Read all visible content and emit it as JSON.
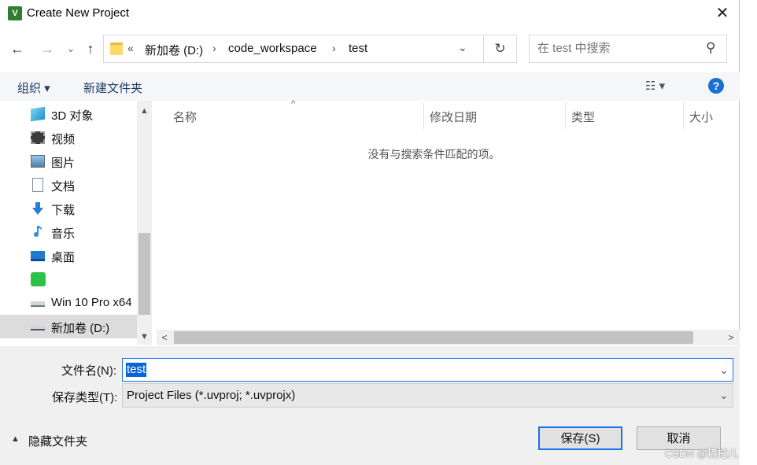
{
  "window": {
    "title": "Create New Project",
    "app_icon_glyph": "V",
    "close_glyph": "✕"
  },
  "nav": {
    "back_glyph": "←",
    "forward_glyph": "→",
    "recent_glyph": "⌄",
    "up_glyph": "↑"
  },
  "address": {
    "overflow": "«",
    "crumbs": [
      "新加卷 (D:)",
      "code_workspace",
      "test"
    ],
    "separator": "›",
    "dropdown_glyph": "⌄",
    "refresh_glyph": "↻"
  },
  "search": {
    "placeholder": "在 test 中搜索",
    "icon_glyph": "⚲"
  },
  "toolbar": {
    "organize": "组织 ▾",
    "new_folder": "新建文件夹",
    "view_glyph": "☷ ▾",
    "help_glyph": "?"
  },
  "sidebar": {
    "items": [
      {
        "label": "3D 对象",
        "icon": "3d-objects-icon"
      },
      {
        "label": "视频",
        "icon": "video-icon"
      },
      {
        "label": "图片",
        "icon": "pictures-icon"
      },
      {
        "label": "文档",
        "icon": "documents-icon"
      },
      {
        "label": "下载",
        "icon": "downloads-icon"
      },
      {
        "label": "音乐",
        "icon": "music-icon"
      },
      {
        "label": "桌面",
        "icon": "desktop-icon"
      },
      {
        "label": "",
        "icon": "iqiyi-icon"
      },
      {
        "label": "Win 10 Pro x64",
        "icon": "drive-icon"
      },
      {
        "label": "新加卷 (D:)",
        "icon": "drive-icon",
        "selected": true
      }
    ],
    "scroll_up_glyph": "▲",
    "scroll_down_glyph": "▼"
  },
  "filelist": {
    "columns": [
      "名称",
      "修改日期",
      "类型",
      "大小"
    ],
    "sort_glyph": "^",
    "empty_message": "没有与搜索条件匹配的项。",
    "scroll_left_glyph": "<",
    "scroll_right_glyph": ">"
  },
  "form": {
    "filename_label": "文件名(N):",
    "filename_value": "test",
    "filetype_label": "保存类型(T):",
    "filetype_value": "Project Files (*.uvproj; *.uvprojx)",
    "dropdown_glyph": "⌄"
  },
  "footer": {
    "hide_folders": "隐藏文件夹",
    "hide_caret": "▲",
    "save_label": "保存(S)",
    "cancel_label": "取消"
  },
  "watermark": "CSDN @耩把儿",
  "colors": {
    "accent": "#1a73e8",
    "selection": "#0a64d6",
    "toolbar_bg": "#f5f6f7",
    "bottom_bg": "#f0f0f0"
  }
}
